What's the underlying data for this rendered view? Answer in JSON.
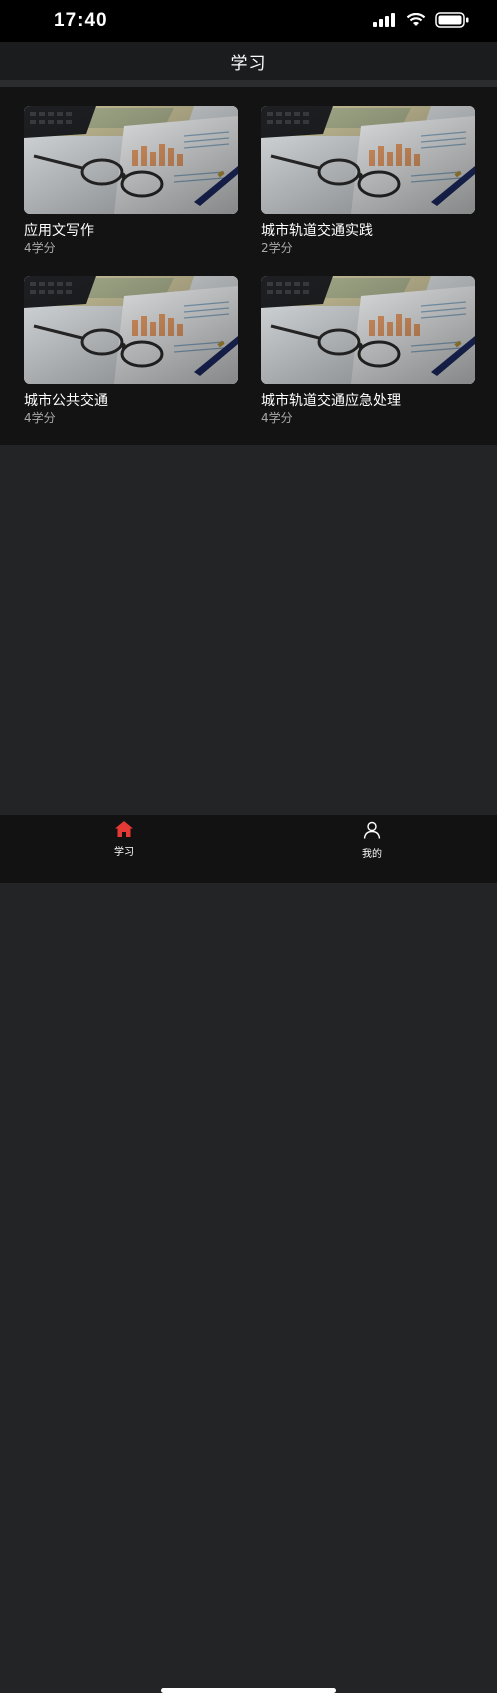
{
  "status_bar": {
    "time": "17:40"
  },
  "nav": {
    "title": "学习"
  },
  "courses": [
    {
      "title": "应用文写作",
      "credits": "4学分"
    },
    {
      "title": "城市轨道交通实践",
      "credits": "2学分"
    },
    {
      "title": "城市公共交通",
      "credits": "4学分"
    },
    {
      "title": "城市轨道交通应急处理",
      "credits": "4学分"
    }
  ],
  "tabs": [
    {
      "label": "学习",
      "icon": "home-icon",
      "active": true
    },
    {
      "label": "我的",
      "icon": "person-icon",
      "active": false
    }
  ],
  "colors": {
    "background": "#222425",
    "content": "#131313",
    "accent_active": "#e53935"
  }
}
